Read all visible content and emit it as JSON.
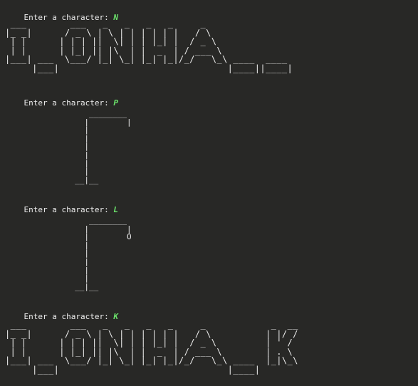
{
  "prompt_label": "Enter a character: ",
  "blocks": [
    {
      "input": "N",
      "banner": " ___        ___   _   _   _   _     _\n|_ _|      / _ \\ | \\ | | | | | |   / \\\n | |      | | | ||  \\| | | |_| |  / _ \\\n | |      | |_| || |\\  | |  _  | / ___ \\\n|___| ___  \\___/ |_| \\_| |_| |_|/_/   \\_\\ ____  ____\n     |___|                               |____||____|"
    },
    {
      "input": "P",
      "gallows": "        ________\n       |        |\n       |\n       |\n       |\n       |\n       |\n       |\n     __|__"
    },
    {
      "input": "L",
      "gallows": "        ________\n       |        |\n       |        O\n       |\n       |\n       |\n       |\n       |\n     __|__"
    },
    {
      "input": "K",
      "banner": " ___        ___   _   _   _   _     _            _  __\n|_ _|      / _ \\ | \\ | | | | | |   / \\          | |/ /\n | |      | | | ||  \\| | | |_| |  / _ \\         | ' /\n | |      | |_| || |\\  | |  _  | / ___ \\        | . \\\n|___| ___  \\___/ |_| \\_| |_| |_|/_/   \\_\\ ____  |_|\\_\\\n     |___|                               |____|"
    }
  ]
}
